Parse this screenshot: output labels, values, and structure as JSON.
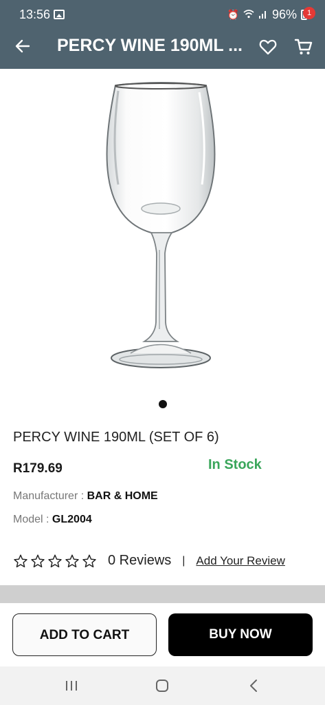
{
  "status_bar": {
    "time": "13:56",
    "battery": "96%",
    "icons": [
      "gallery-icon",
      "alarm-icon",
      "wifi-icon",
      "signal-icon",
      "battery-icon"
    ]
  },
  "app_bar": {
    "title": "PERCY WINE 190ML ...",
    "cart_count": "1",
    "background": "#4f636f"
  },
  "product": {
    "name": "PERCY WINE 190ML (SET OF 6)",
    "price": "R179.69",
    "stock_status": "In Stock",
    "manufacturer_label": "Manufacturer : ",
    "manufacturer": "BAR & HOME",
    "model_label": "Model : ",
    "model": "GL2004",
    "rating_stars": 0,
    "reviews": "0 Reviews",
    "separator": "|",
    "add_review": "Add Your Review"
  },
  "actions": {
    "add_to_cart": "ADD TO CART",
    "buy_now": "BUY NOW"
  },
  "colors": {
    "stock_green": "#3aa65b",
    "badge_red": "#e53935"
  }
}
